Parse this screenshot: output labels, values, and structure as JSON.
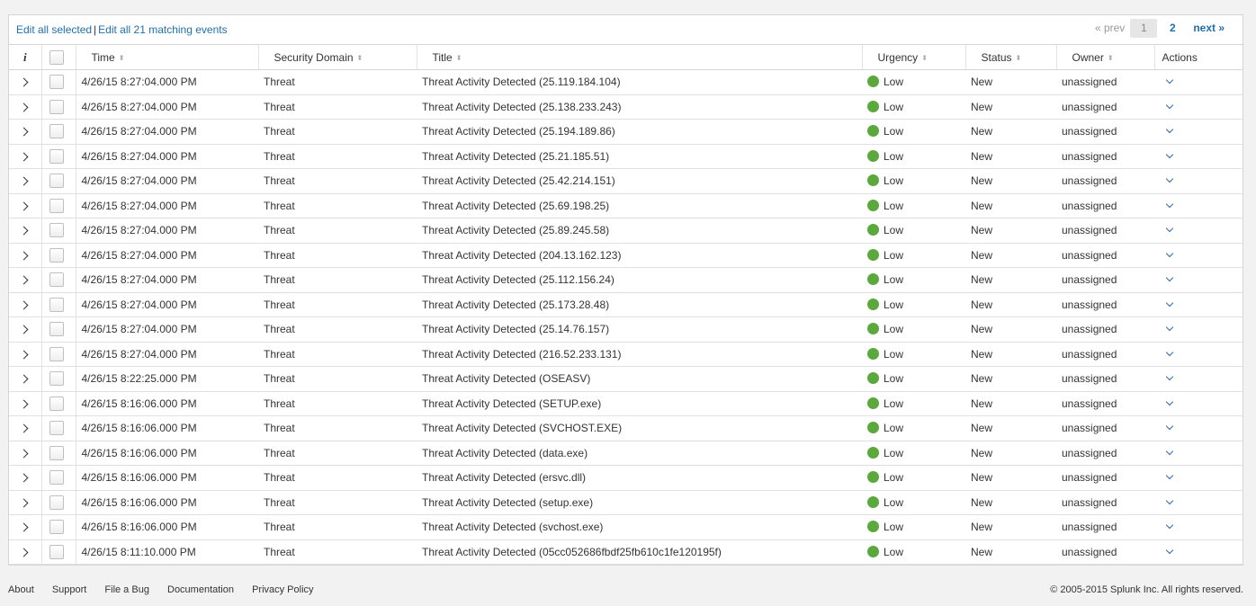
{
  "toolbar": {
    "edit_selected": "Edit all selected",
    "separator": "|",
    "edit_matching": "Edit all 21 matching events"
  },
  "pager": {
    "prev": "« prev",
    "current": "1",
    "page2": "2",
    "next": "next »"
  },
  "columns": {
    "info": "i",
    "time": "Time",
    "domain": "Security Domain",
    "title": "Title",
    "urgency": "Urgency",
    "status": "Status",
    "owner": "Owner",
    "actions": "Actions"
  },
  "colors": {
    "urgency_low": "#5ba83c",
    "link": "#1e6fb0"
  },
  "rows": [
    {
      "time": "4/26/15 8:27:04.000 PM",
      "domain": "Threat",
      "title": "Threat Activity Detected (25.119.184.104)",
      "urgency": "Low",
      "status": "New",
      "owner": "unassigned"
    },
    {
      "time": "4/26/15 8:27:04.000 PM",
      "domain": "Threat",
      "title": "Threat Activity Detected (25.138.233.243)",
      "urgency": "Low",
      "status": "New",
      "owner": "unassigned"
    },
    {
      "time": "4/26/15 8:27:04.000 PM",
      "domain": "Threat",
      "title": "Threat Activity Detected (25.194.189.86)",
      "urgency": "Low",
      "status": "New",
      "owner": "unassigned"
    },
    {
      "time": "4/26/15 8:27:04.000 PM",
      "domain": "Threat",
      "title": "Threat Activity Detected (25.21.185.51)",
      "urgency": "Low",
      "status": "New",
      "owner": "unassigned"
    },
    {
      "time": "4/26/15 8:27:04.000 PM",
      "domain": "Threat",
      "title": "Threat Activity Detected (25.42.214.151)",
      "urgency": "Low",
      "status": "New",
      "owner": "unassigned"
    },
    {
      "time": "4/26/15 8:27:04.000 PM",
      "domain": "Threat",
      "title": "Threat Activity Detected (25.69.198.25)",
      "urgency": "Low",
      "status": "New",
      "owner": "unassigned"
    },
    {
      "time": "4/26/15 8:27:04.000 PM",
      "domain": "Threat",
      "title": "Threat Activity Detected (25.89.245.58)",
      "urgency": "Low",
      "status": "New",
      "owner": "unassigned"
    },
    {
      "time": "4/26/15 8:27:04.000 PM",
      "domain": "Threat",
      "title": "Threat Activity Detected (204.13.162.123)",
      "urgency": "Low",
      "status": "New",
      "owner": "unassigned"
    },
    {
      "time": "4/26/15 8:27:04.000 PM",
      "domain": "Threat",
      "title": "Threat Activity Detected (25.112.156.24)",
      "urgency": "Low",
      "status": "New",
      "owner": "unassigned"
    },
    {
      "time": "4/26/15 8:27:04.000 PM",
      "domain": "Threat",
      "title": "Threat Activity Detected (25.173.28.48)",
      "urgency": "Low",
      "status": "New",
      "owner": "unassigned"
    },
    {
      "time": "4/26/15 8:27:04.000 PM",
      "domain": "Threat",
      "title": "Threat Activity Detected (25.14.76.157)",
      "urgency": "Low",
      "status": "New",
      "owner": "unassigned"
    },
    {
      "time": "4/26/15 8:27:04.000 PM",
      "domain": "Threat",
      "title": "Threat Activity Detected (216.52.233.131)",
      "urgency": "Low",
      "status": "New",
      "owner": "unassigned"
    },
    {
      "time": "4/26/15 8:22:25.000 PM",
      "domain": "Threat",
      "title": "Threat Activity Detected (OSEASV)",
      "urgency": "Low",
      "status": "New",
      "owner": "unassigned"
    },
    {
      "time": "4/26/15 8:16:06.000 PM",
      "domain": "Threat",
      "title": "Threat Activity Detected (SETUP.exe)",
      "urgency": "Low",
      "status": "New",
      "owner": "unassigned"
    },
    {
      "time": "4/26/15 8:16:06.000 PM",
      "domain": "Threat",
      "title": "Threat Activity Detected (SVCHOST.EXE)",
      "urgency": "Low",
      "status": "New",
      "owner": "unassigned"
    },
    {
      "time": "4/26/15 8:16:06.000 PM",
      "domain": "Threat",
      "title": "Threat Activity Detected (data.exe)",
      "urgency": "Low",
      "status": "New",
      "owner": "unassigned"
    },
    {
      "time": "4/26/15 8:16:06.000 PM",
      "domain": "Threat",
      "title": "Threat Activity Detected (ersvc.dll)",
      "urgency": "Low",
      "status": "New",
      "owner": "unassigned"
    },
    {
      "time": "4/26/15 8:16:06.000 PM",
      "domain": "Threat",
      "title": "Threat Activity Detected (setup.exe)",
      "urgency": "Low",
      "status": "New",
      "owner": "unassigned"
    },
    {
      "time": "4/26/15 8:16:06.000 PM",
      "domain": "Threat",
      "title": "Threat Activity Detected (svchost.exe)",
      "urgency": "Low",
      "status": "New",
      "owner": "unassigned"
    },
    {
      "time": "4/26/15 8:11:10.000 PM",
      "domain": "Threat",
      "title": "Threat Activity Detected (05cc052686fbdf25fb610c1fe120195f)",
      "urgency": "Low",
      "status": "New",
      "owner": "unassigned"
    }
  ],
  "footer": {
    "links": [
      "About",
      "Support",
      "File a Bug",
      "Documentation",
      "Privacy Policy"
    ],
    "copyright": "© 2005-2015 Splunk Inc. All rights reserved."
  }
}
